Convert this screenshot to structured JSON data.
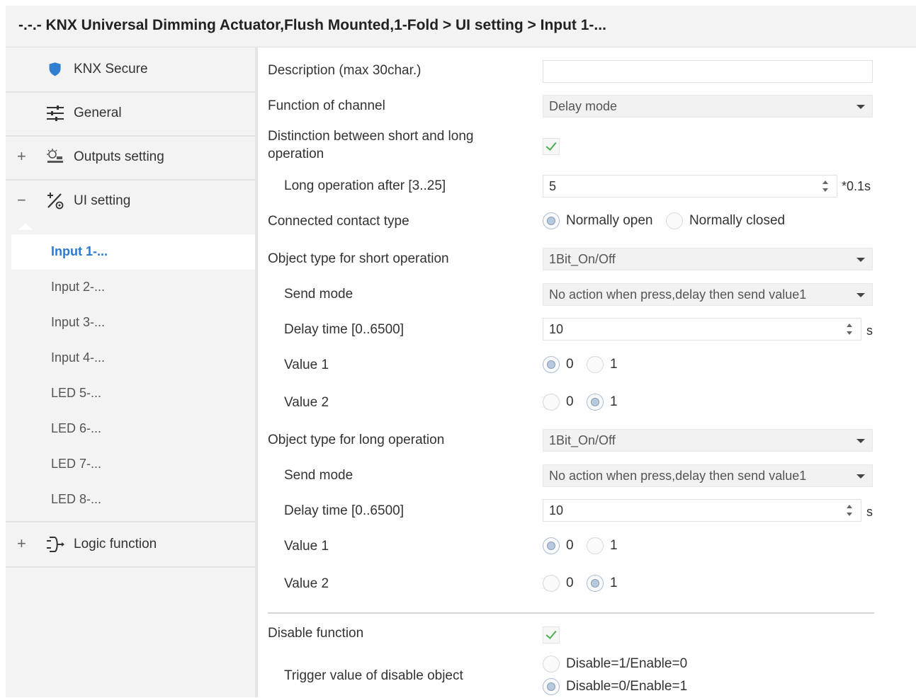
{
  "window": {
    "title": "-.-.- KNX Universal Dimming Actuator,Flush Mounted,1-Fold > UI setting > Input 1-..."
  },
  "sidebar": {
    "items": [
      {
        "label": "KNX Secure",
        "icon": "shield-icon",
        "expander": ""
      },
      {
        "label": "General",
        "icon": "sliders-icon",
        "expander": ""
      },
      {
        "label": "Outputs setting",
        "icon": "outputs-icon",
        "expander": "+"
      },
      {
        "label": "UI setting",
        "icon": "ui-setting-icon",
        "expander": "−"
      }
    ],
    "subitems": [
      {
        "label": "Input 1-...",
        "selected": true
      },
      {
        "label": "Input 2-..."
      },
      {
        "label": "Input 3-..."
      },
      {
        "label": "Input 4-..."
      },
      {
        "label": "LED 5-..."
      },
      {
        "label": "LED 6-..."
      },
      {
        "label": "LED 7-..."
      },
      {
        "label": "LED 8-..."
      }
    ],
    "logic": {
      "label": "Logic function",
      "icon": "logic-icon",
      "expander": "+"
    }
  },
  "params": {
    "description": {
      "label": "Description (max 30char.)",
      "value": ""
    },
    "function_of_channel": {
      "label": "Function of channel",
      "value": "Delay mode"
    },
    "distinction": {
      "label_line1": "Distinction between short and long",
      "label_line2": "operation",
      "checked": true
    },
    "long_operation_after": {
      "label": "Long operation after [3..25]",
      "value": "5",
      "unit": "*0.1s"
    },
    "contact_type": {
      "label": "Connected contact type",
      "options": [
        "Normally open",
        "Normally closed"
      ],
      "selected": "Normally open"
    },
    "short_object_type": {
      "label": "Object type for short operation",
      "value": "1Bit_On/Off"
    },
    "short_send_mode": {
      "label": "Send mode",
      "value": "No action when press,delay then send value1"
    },
    "short_delay_time": {
      "label": "Delay time [0..6500]",
      "value": "10",
      "unit": "s"
    },
    "short_value1": {
      "label": "Value 1",
      "options": [
        "0",
        "1"
      ],
      "selected": "0"
    },
    "short_value2": {
      "label": "Value 2",
      "options": [
        "0",
        "1"
      ],
      "selected": "1"
    },
    "long_object_type": {
      "label": "Object type for long operation",
      "value": "1Bit_On/Off"
    },
    "long_send_mode": {
      "label": "Send mode",
      "value": "No action when press,delay then send value1"
    },
    "long_delay_time": {
      "label": "Delay time [0..6500]",
      "value": "10",
      "unit": "s"
    },
    "long_value1": {
      "label": "Value 1",
      "options": [
        "0",
        "1"
      ],
      "selected": "0"
    },
    "long_value2": {
      "label": "Value 2",
      "options": [
        "0",
        "1"
      ],
      "selected": "1"
    },
    "disable_function": {
      "label": "Disable function",
      "checked": true
    },
    "trigger_value": {
      "label": "Trigger value of disable object",
      "options": [
        "Disable=1/Enable=0",
        "Disable=0/Enable=1"
      ],
      "selected": "Disable=0/Enable=1"
    }
  }
}
